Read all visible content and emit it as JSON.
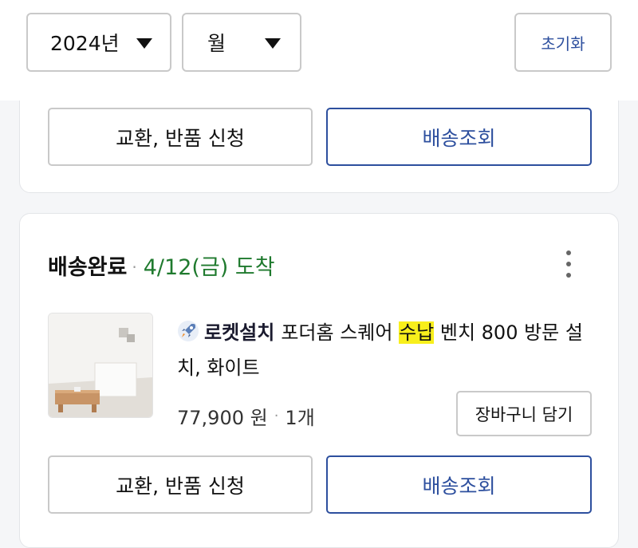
{
  "filters": {
    "year": "2024년",
    "month": "월",
    "reset_label": "초기화"
  },
  "prev_order": {
    "exchange_label": "교환, 반품 신청",
    "track_label": "배송조회"
  },
  "order": {
    "status": "배송완료",
    "separator": "·",
    "arrival": "4/12(금) 도착",
    "more_icon": "more-vertical-icon",
    "product": {
      "badge_icon": "rocket-icon",
      "badge": "로켓설치",
      "title_before": "포더홈 스퀘어 ",
      "title_highlight": "수납",
      "title_after": " 벤치 800 방문 설치, 화이트",
      "price": "77,900 원",
      "qty_separator": "·",
      "quantity": "1개",
      "cart_label": "장바구니 담기"
    },
    "exchange_label": "교환, 반품 신청",
    "track_label": "배송조회"
  },
  "colors": {
    "accent_blue": "#2d4f9e",
    "arrival_green": "#1f7a2e",
    "highlight_yellow": "#f8ef1c"
  }
}
